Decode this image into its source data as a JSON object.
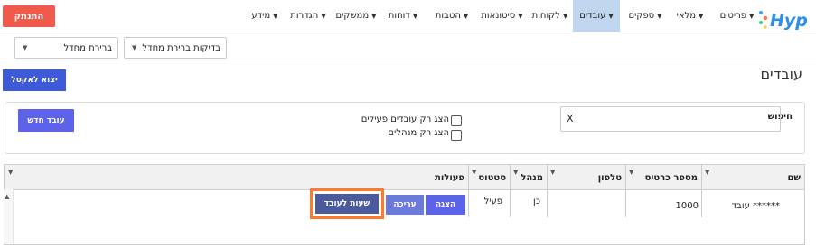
{
  "header": {
    "logout_label": "התנתק",
    "logo_text": "Hyp",
    "nav": [
      {
        "label": "פריטים",
        "active": false
      },
      {
        "label": "מלאי",
        "active": false
      },
      {
        "label": "ספקים",
        "active": false
      },
      {
        "label": "עובדים",
        "active": true
      },
      {
        "label": "לקוחות",
        "active": false
      },
      {
        "label": "סיטונאות",
        "active": false
      },
      {
        "label": "הטבות",
        "active": false
      },
      {
        "label": "דוחות",
        "active": false
      },
      {
        "label": "ממשקים",
        "active": false
      },
      {
        "label": "הגדרות",
        "active": false
      },
      {
        "label": "מידע",
        "active": false
      }
    ],
    "select_checks": "בדיקות ברירת מחדל",
    "select_default": "ברירת מחדל"
  },
  "page": {
    "title": "עובדים",
    "export_label": "יצוא לאקסל"
  },
  "search": {
    "label": "חיפוש",
    "value": "X",
    "only_active_label": "הצג רק עובדים פעילים",
    "only_managers_label": "הצג רק מנהלים",
    "new_employee_label": "עובד חדש"
  },
  "grid": {
    "columns": {
      "name": "שם",
      "card_number": "מספר כרטיס",
      "phone": "טלפון",
      "manager": "מנהל",
      "status": "סטטוס",
      "actions": "פעולות"
    },
    "rows": [
      {
        "name": "עובד ******",
        "card_number": "1000",
        "phone": "",
        "manager": "כן",
        "status": "פעיל",
        "btn_show": "הצגה",
        "btn_edit": "עריכה",
        "btn_hours": "שעות לעובד"
      }
    ]
  },
  "colors": {
    "accent": "#5c63e8",
    "logout": "#f05a4a",
    "highlight": "#ff7a2b",
    "active_nav": "#bfd6ee"
  }
}
